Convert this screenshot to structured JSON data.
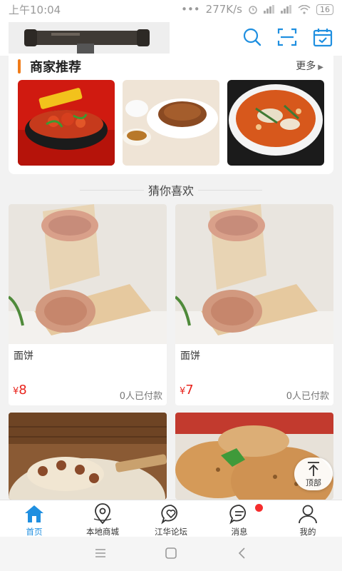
{
  "status_bar": {
    "time": "上午10:04",
    "net_speed": "277K/s",
    "battery": "16"
  },
  "header": {
    "logo_icon": "brand-logo-image",
    "icons": [
      "search-icon",
      "scan-icon",
      "calendar-check-icon"
    ],
    "accent_color": "#1f8fe0"
  },
  "merchant": {
    "title": "商家推荐",
    "more": "更多",
    "accent_color": "#f07c1a",
    "thumbs": [
      "spicy-crayfish-bowl-image",
      "fried-rice-plate-image",
      "fish-soup-image"
    ]
  },
  "guess": {
    "title": "猜你喜欢"
  },
  "products": [
    {
      "name": "面饼",
      "currency": "¥",
      "price": "8",
      "sold": "0人已付款",
      "image": "wrap-image"
    },
    {
      "name": "面饼",
      "currency": "¥",
      "price": "7",
      "sold": "0人已付款",
      "image": "wrap-image"
    },
    {
      "name": "",
      "currency": "",
      "price": "",
      "sold": "",
      "image": "dumplings-image"
    },
    {
      "name": "",
      "currency": "",
      "price": "",
      "sold": "",
      "image": "pancake-image"
    }
  ],
  "top_button": {
    "label": "顶部"
  },
  "bottom_nav": {
    "items": [
      {
        "label": "首页",
        "icon": "home-icon",
        "active": true
      },
      {
        "label": "本地商城",
        "icon": "map-pin-icon",
        "active": false
      },
      {
        "label": "江华论坛",
        "icon": "heart-chat-icon",
        "active": false
      },
      {
        "label": "消息",
        "icon": "message-icon",
        "active": false
      },
      {
        "label": "我的",
        "icon": "user-icon",
        "active": false
      }
    ],
    "active_color": "#1f8fe0",
    "badge_color": "#f52d2d"
  },
  "system_nav": [
    "menu-icon",
    "home-square-icon",
    "back-icon"
  ]
}
